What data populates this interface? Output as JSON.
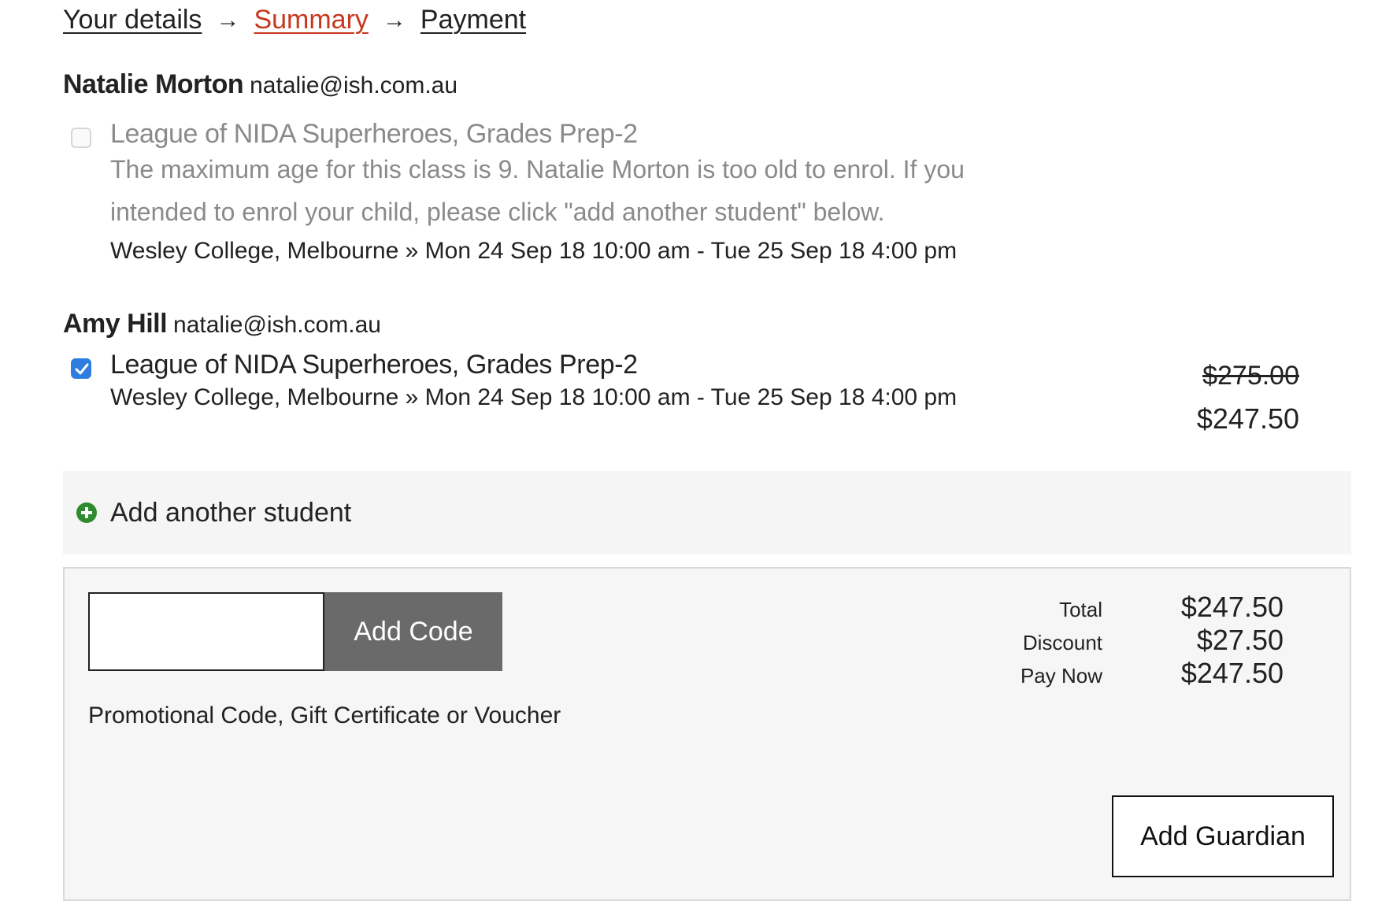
{
  "breadcrumb": {
    "steps": [
      "Your details",
      "Summary",
      "Payment"
    ],
    "active": "Summary",
    "separator_icon": "arrow-right-icon",
    "active_color": "#c8371d"
  },
  "students": [
    {
      "name": "Natalie Morton",
      "email": "natalie@ish.com.au",
      "enrolment": {
        "checked": false,
        "disabled": true,
        "class_title": "League of NIDA Superheroes, Grades Prep-2",
        "warning_line1": "The maximum age for this class is 9. Natalie Morton is too old to enrol. If you",
        "warning_line2": "intended to enrol your child, please click \"add another student\" below.",
        "venue": "Wesley College, Melbourne » Mon 24 Sep 18 10:00 am - Tue 25 Sep 18 4:00 pm"
      }
    },
    {
      "name": "Amy Hill",
      "email": "natalie@ish.com.au",
      "enrolment": {
        "checked": true,
        "disabled": false,
        "class_title": "League of NIDA Superheroes, Grades Prep-2",
        "venue": "Wesley College, Melbourne » Mon 24 Sep 18 10:00 am - Tue 25 Sep 18 4:00 pm",
        "price_original": "$275.00",
        "price_discounted": "$247.50"
      }
    }
  ],
  "add_student": {
    "label": "Add another student",
    "icon": "plus-circle-icon",
    "icon_color": "#2e8b2e"
  },
  "promo": {
    "input_value": "",
    "button_label": "Add Code",
    "help_text": "Promotional Code, Gift Certificate or Voucher"
  },
  "totals": {
    "total_label": "Total",
    "total_value": "$247.50",
    "discount_label": "Discount",
    "discount_value": "$27.50",
    "pay_now_label": "Pay Now",
    "pay_now_value": "$247.50"
  },
  "add_guardian_label": "Add Guardian",
  "checkbox_color": "#2f7de1"
}
